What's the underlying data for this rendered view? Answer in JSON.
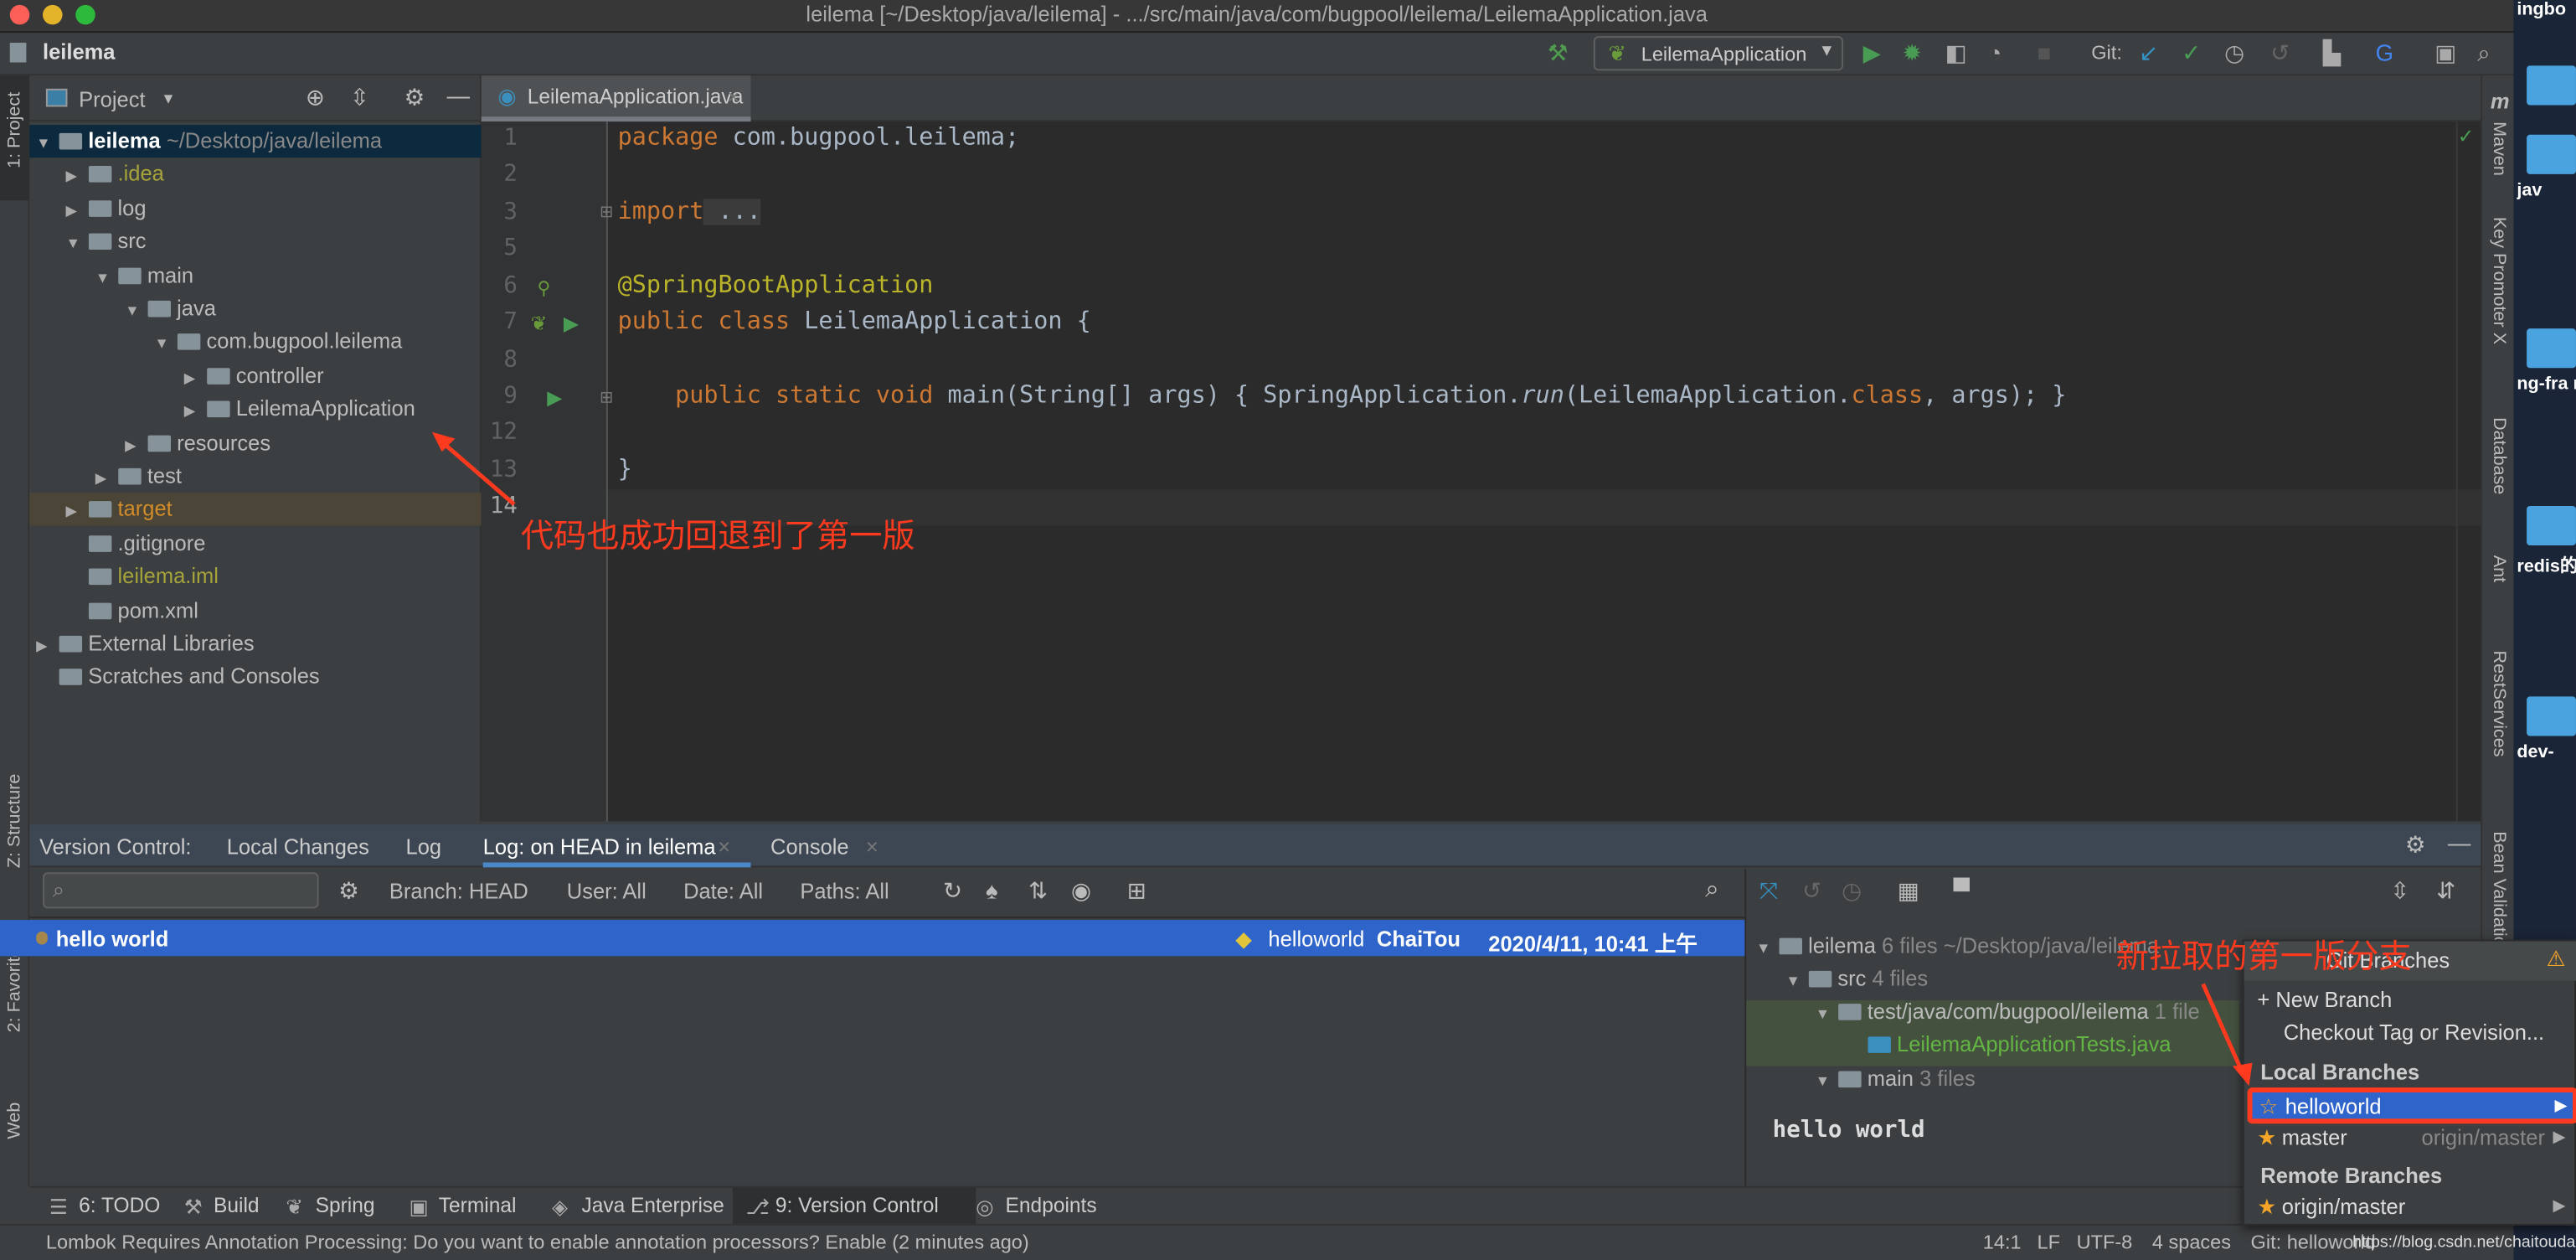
{
  "window": {
    "title": "leilema [~/Desktop/java/leilema] - .../src/main/java/com/bugpool/leilema/LeilemaApplication.java"
  },
  "navbar": {
    "project": "leilema",
    "run_config": "LeilemaApplication",
    "git_label": "Git:"
  },
  "left_strip": {
    "project": "1: Project",
    "structure": "Z: Structure",
    "favorites": "2: Favorites",
    "web": "Web"
  },
  "right_strip": [
    "Maven",
    "Key Promoter X",
    "Database",
    "Ant",
    "RestServices",
    "Bean Validation"
  ],
  "project_panel": {
    "title": "Project",
    "tree": [
      {
        "label": "leilema",
        "extra": "~/Desktop/java/leilema",
        "color": "#ffffff"
      },
      {
        "label": ".idea",
        "color": "#a5a33a"
      },
      {
        "label": "log"
      },
      {
        "label": "src"
      },
      {
        "label": "main"
      },
      {
        "label": "java"
      },
      {
        "label": "com.bugpool.leilema"
      },
      {
        "label": "controller"
      },
      {
        "label": "LeilemaApplication"
      },
      {
        "label": "resources"
      },
      {
        "label": "test"
      },
      {
        "label": "target",
        "color": "#d08c2a"
      },
      {
        "label": ".gitignore"
      },
      {
        "label": "leilema.iml",
        "color": "#a5a33a"
      },
      {
        "label": "pom.xml"
      },
      {
        "label": "External Libraries"
      },
      {
        "label": "Scratches and Consoles"
      }
    ]
  },
  "editor": {
    "tab": "LeilemaApplication.java",
    "line_numbers": [
      "1",
      "2",
      "3",
      "5",
      "6",
      "7",
      "8",
      "9",
      "12",
      "13",
      "14"
    ],
    "code": {
      "l1a": "package",
      "l1b": " com.bugpool.leilema;",
      "l3a": "import",
      "l3b": " ...",
      "l6": "@SpringBootApplication",
      "l7a": "public class",
      "l7b": " LeilemaApplication {",
      "l9a": "public static void",
      "l9b": " main(String[] args) { SpringApplication.",
      "l9c": "run",
      "l9d": "(LeilemaApplication.",
      "l9e": "class",
      "l9f": ", args); }",
      "l13": "}"
    }
  },
  "annotations": {
    "editor": "代码也成功回退到了第一版",
    "branch": "新拉取的第一版分支"
  },
  "vc_panel": {
    "tabs": [
      "Version Control:",
      "Local Changes",
      "Log",
      "Log: on HEAD in leilema",
      "Console"
    ],
    "filters": {
      "branch": "Branch: HEAD",
      "user": "User: All",
      "date": "Date: All",
      "paths": "Paths: All"
    },
    "commit": {
      "message": "hello world",
      "tag": "helloworld",
      "author": "ChaiTou",
      "date": "2020/4/11, 10:41 上午"
    },
    "changes": [
      {
        "label": "leilema",
        "extra": "6 files  ~/Desktop/java/leilema"
      },
      {
        "label": "src",
        "extra": "4 files"
      },
      {
        "label": "test/java/com/bugpool/leilema",
        "extra": "1 file"
      },
      {
        "label": "LeilemaApplicationTests.java",
        "extra": ""
      },
      {
        "label": "main",
        "extra": "3 files"
      }
    ],
    "detail_message": "hello world"
  },
  "git_branches_popup": {
    "title": "Git Branches",
    "new_branch": "+ New Branch",
    "checkout": "Checkout Tag or Revision...",
    "local_header": "Local Branches",
    "local": [
      {
        "name": "helloworld",
        "tracking": ""
      },
      {
        "name": "master",
        "tracking": "origin/master"
      }
    ],
    "remote_header": "Remote Branches",
    "remote": [
      {
        "name": "origin/master"
      }
    ]
  },
  "tool_windows": [
    "6: TODO",
    "Build",
    "Spring",
    "Terminal",
    "Java Enterprise",
    "9: Version Control",
    "Endpoints"
  ],
  "status": {
    "message": "Lombok Requires Annotation Processing: Do you want to enable annotation processors? Enable (2 minutes ago)",
    "position": "14:1",
    "line_sep": "LF",
    "encoding": "UTF-8",
    "indent": "4 spaces",
    "git": "Git: helloworld",
    "watermark": "https://blog.csdn.net/chaitoudaren"
  },
  "desktop": {
    "items": [
      "ingbo",
      "jav",
      "ng-fra mas",
      "redis的",
      "dev-"
    ]
  },
  "colors": {
    "accent": "#2f65ca",
    "annotation": "#ff3a1e",
    "star": "#f4a528"
  }
}
